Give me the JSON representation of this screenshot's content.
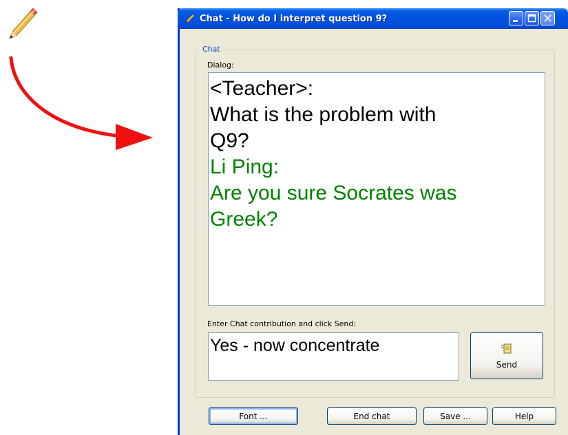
{
  "window": {
    "title": "Chat - How do I interpret question 9?"
  },
  "group": {
    "label": "Chat"
  },
  "dialog": {
    "label": "Dialog:",
    "lines": [
      {
        "text": "<Teacher>:",
        "role": "teacher"
      },
      {
        "text": "What is the problem with",
        "role": "teacher"
      },
      {
        "text": "Q9?",
        "role": "teacher"
      },
      {
        "text": "Li Ping:",
        "role": "student"
      },
      {
        "text": "Are you sure Socrates was",
        "role": "student"
      },
      {
        "text": "Greek?",
        "role": "student"
      }
    ]
  },
  "entry": {
    "label": "Enter Chat contribution and click Send:",
    "value": "Yes - now concentrate"
  },
  "buttons": {
    "send": "Send",
    "font": "Font ...",
    "end_chat": "End chat",
    "save": "Save ...",
    "help": "Help"
  },
  "colors": {
    "teacher_text": "#000000",
    "student_text": "#008000",
    "arrow": "#ee1111",
    "titlebar": "#0054e3"
  },
  "icons": {
    "annotation": "pencil-icon",
    "title": "pencil-icon",
    "send": "notepad-icon"
  }
}
